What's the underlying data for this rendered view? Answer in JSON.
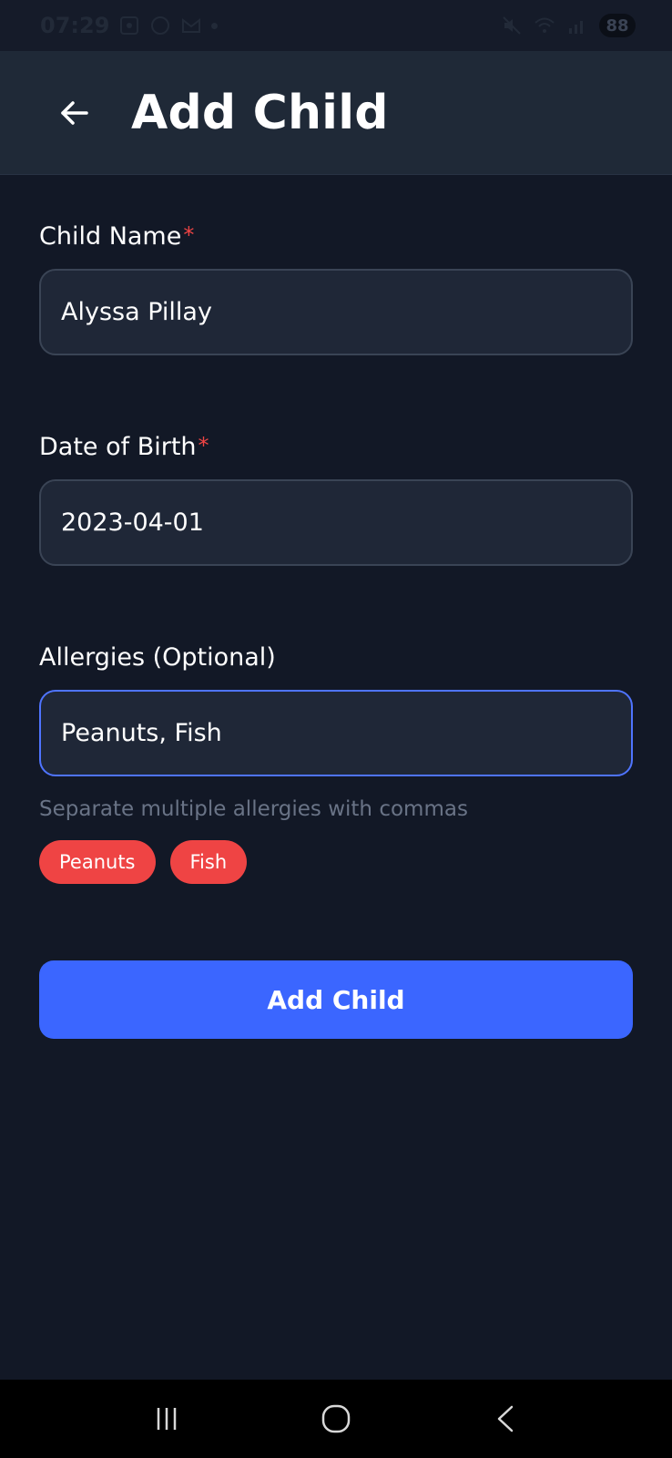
{
  "status_bar": {
    "time": "07:29",
    "battery": "88"
  },
  "header": {
    "title": "Add Child"
  },
  "form": {
    "child_name": {
      "label": "Child Name",
      "required_mark": "*",
      "value": "Alyssa Pillay"
    },
    "date_of_birth": {
      "label": "Date of Birth",
      "required_mark": "*",
      "value": "2023-04-01"
    },
    "allergies": {
      "label": "Allergies (Optional)",
      "value": "Peanuts, Fish",
      "helper": "Separate multiple allergies with commas",
      "chips": [
        "Peanuts",
        "Fish"
      ]
    },
    "submit_label": "Add Child"
  },
  "colors": {
    "background": "#121826",
    "app_bar": "#1f2937",
    "input_bg": "#1f2737",
    "input_border": "#3a4455",
    "focus_border": "#4f74ff",
    "primary": "#3b66ff",
    "chip": "#ef4444",
    "required": "#ef4444",
    "helper_text": "#697386"
  },
  "icons": {
    "back": "arrow-left-icon",
    "nav_recents": "recents-icon",
    "nav_home": "home-icon",
    "nav_back": "back-chevron-icon"
  }
}
